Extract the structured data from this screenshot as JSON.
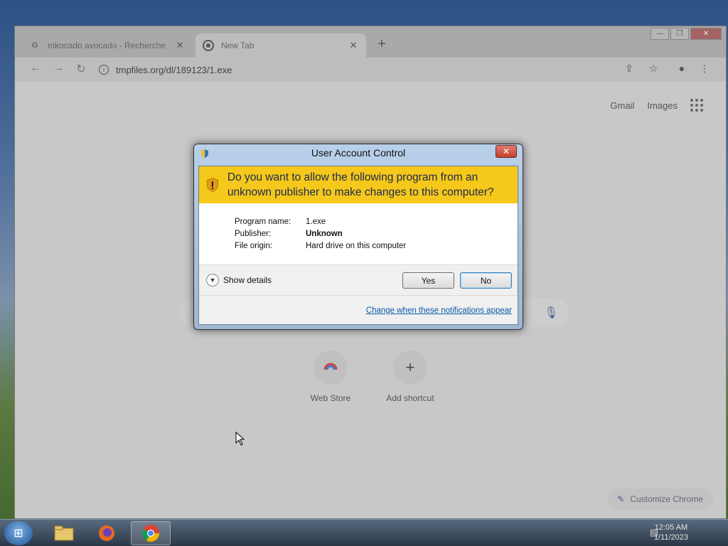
{
  "browser": {
    "tabs": [
      {
        "label": "mkocado avocado - Recherche",
        "favicon": "G",
        "active": false
      },
      {
        "label": "New Tab",
        "favicon": "chrome-icon",
        "active": true
      }
    ],
    "url": "tmpfiles.org/dl/189123/1.exe"
  },
  "newtab": {
    "links": {
      "gmail": "Gmail",
      "images": "Images"
    },
    "shortcuts": [
      {
        "label": "Web Store",
        "icon": "web-store-icon"
      },
      {
        "label": "Add shortcut",
        "icon": "plus-icon"
      }
    ],
    "customize_label": "Customize Chrome"
  },
  "uac": {
    "title": "User Account Control",
    "question": "Do you want to allow the following program from an unknown publisher to make changes to this computer?",
    "fields": [
      {
        "key": "Program name:",
        "value": "1.exe",
        "bold": false
      },
      {
        "key": "Publisher:",
        "value": "Unknown",
        "bold": true
      },
      {
        "key": "File origin:",
        "value": "Hard drive on this computer",
        "bold": false
      }
    ],
    "show_details": "Show details",
    "yes_label": "Yes",
    "no_label": "No",
    "change_link": "Change when these notifications appear",
    "banner_color": "#f6c81b"
  },
  "taskbar": {
    "clock_time": "12:05 AM",
    "clock_date": "1/11/2023"
  }
}
